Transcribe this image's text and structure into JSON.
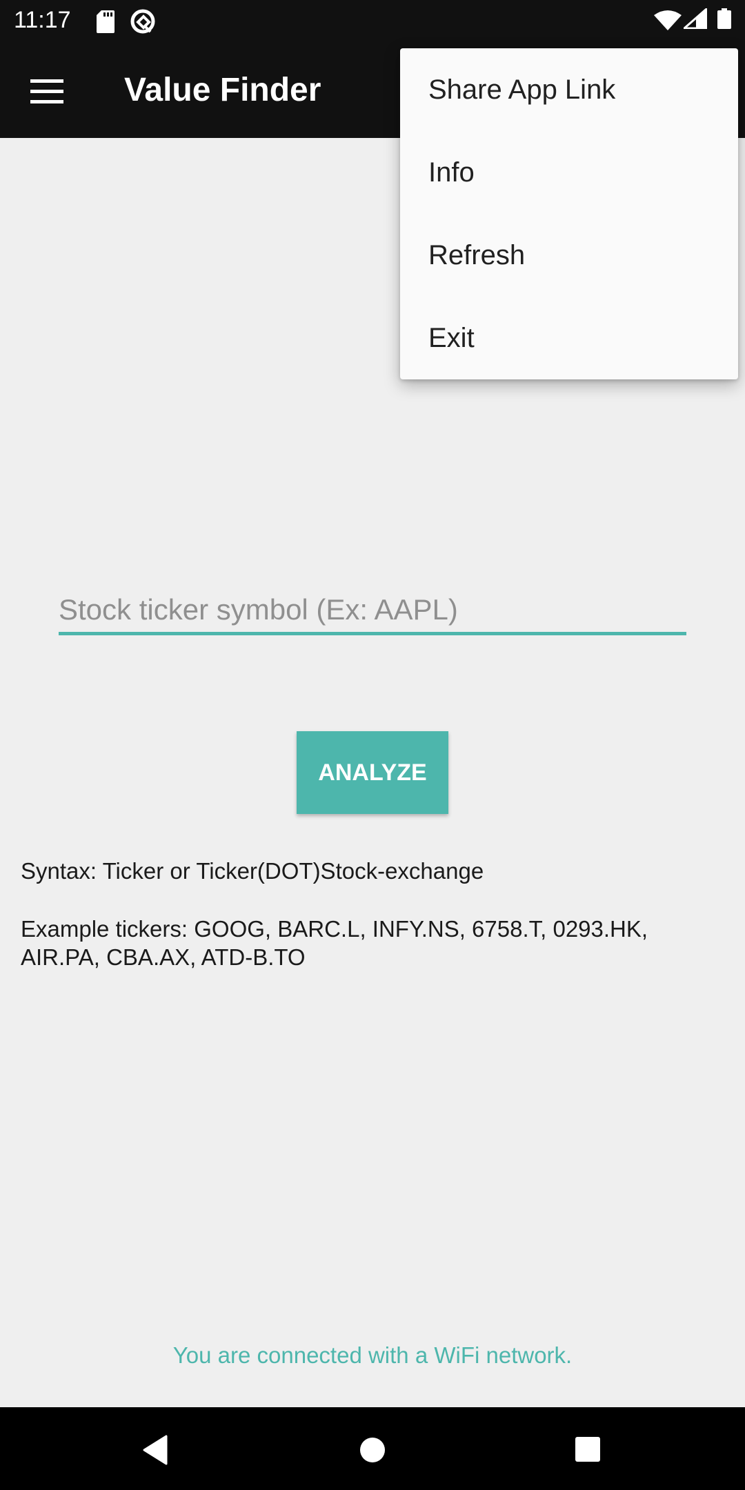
{
  "status_bar": {
    "time": "11:17",
    "left_icons": [
      "sd-card-icon",
      "data-saver-icon"
    ],
    "right_icons": [
      "wifi-icon",
      "cell-signal-icon",
      "battery-icon"
    ]
  },
  "app_bar": {
    "menu_icon": "hamburger-icon",
    "title": "Value Finder"
  },
  "overflow_menu": {
    "items": [
      {
        "label": "Share App Link"
      },
      {
        "label": "Info"
      },
      {
        "label": "Refresh"
      },
      {
        "label": "Exit"
      }
    ]
  },
  "form": {
    "ticker_value": "",
    "ticker_placeholder": "Stock ticker symbol (Ex: AAPL)",
    "analyze_label": "ANALYZE"
  },
  "help": {
    "syntax": "Syntax: Ticker or Ticker(DOT)Stock-exchange",
    "examples": "Example tickers: GOOG, BARC.L, INFY.NS, 6758.T, 0293.HK, AIR.PA, CBA.AX, ATD-B.TO"
  },
  "footer": {
    "connection_status": "You are connected with a WiFi network."
  },
  "nav_bar": {
    "buttons": [
      "back-icon",
      "home-icon",
      "recents-icon"
    ]
  },
  "colors": {
    "accent": "#4db6ac",
    "app_bar": "#111111",
    "background": "#efefef",
    "menu_background": "#fafafa"
  }
}
